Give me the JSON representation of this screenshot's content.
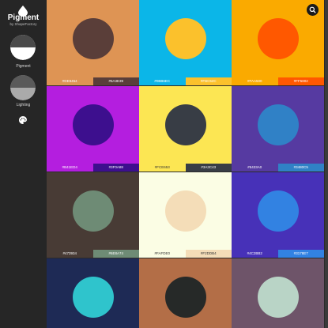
{
  "app": {
    "title": "Pigment",
    "subtitle": "by ShapeFactory"
  },
  "sidebar": {
    "items": [
      {
        "label": "Pigment",
        "icon": "half-circle-icon"
      },
      {
        "label": "Lighting",
        "icon": "lighting-circle-icon"
      }
    ],
    "palette_icon": "palette-icon"
  },
  "toolbar": {
    "search_icon": "search-icon"
  },
  "grid": {
    "cells": [
      {
        "bg": "#DE9454",
        "circle": "#5A3E39",
        "codes": [
          "#DE9454",
          "#5A3E39"
        ],
        "dark_text": [
          false,
          false
        ]
      },
      {
        "bg": "#0BB6E8",
        "circle": "#FBC12C",
        "codes": [
          "#0BB6EC",
          "#FBC52C"
        ],
        "dark_text": [
          false,
          false
        ]
      },
      {
        "bg": "#FAAA00",
        "circle": "#FF5800",
        "codes": [
          "#FAA500",
          "#FF5802"
        ],
        "dark_text": [
          false,
          false
        ]
      },
      {
        "bg": "#B41EDF",
        "circle": "#3D0F8E",
        "codes": [
          "#B41ED4",
          "#3F0A88"
        ],
        "dark_text": [
          false,
          false
        ]
      },
      {
        "bg": "#FCE653",
        "circle": "#383D45",
        "codes": [
          "#FCE653",
          "#3A3C43"
        ],
        "dark_text": [
          true,
          false
        ]
      },
      {
        "bg": "#563AA1",
        "circle": "#3081C6",
        "codes": [
          "#5433A0",
          "#3480C5"
        ],
        "dark_text": [
          false,
          false
        ]
      },
      {
        "bg": "#483B35",
        "circle": "#6E8B75",
        "codes": [
          "#473934",
          "#6E8A74"
        ],
        "dark_text": [
          false,
          false
        ]
      },
      {
        "bg": "#FBFDE4",
        "circle": "#F4DDB8",
        "codes": [
          "#FAFDE0",
          "#F2DDB4"
        ],
        "dark_text": [
          true,
          true
        ]
      },
      {
        "bg": "#4731B8",
        "circle": "#3282E2",
        "codes": [
          "#4C2BB2",
          "#3178E7"
        ],
        "dark_text": [
          false,
          false
        ]
      },
      {
        "bg": "#1E2A55",
        "circle": "#2FC4CC",
        "codes": [],
        "dark_text": []
      },
      {
        "bg": "#B36E47",
        "circle": "#262928",
        "codes": [],
        "dark_text": []
      },
      {
        "bg": "#6E5469",
        "circle": "#B9D4C6",
        "codes": [],
        "dark_text": []
      }
    ]
  }
}
